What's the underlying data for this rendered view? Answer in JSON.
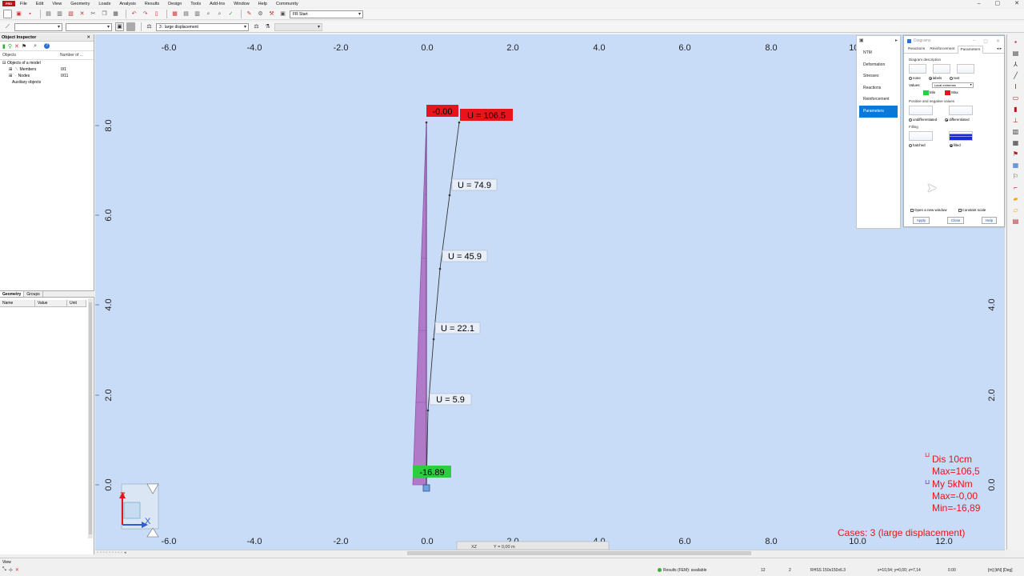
{
  "app": {
    "logo": "FRD"
  },
  "menu": [
    "File",
    "Edit",
    "View",
    "Geometry",
    "Loads",
    "Analysis",
    "Results",
    "Design",
    "Tools",
    "Add-Ins",
    "Window",
    "Help",
    "Community"
  ],
  "toolbar": {
    "start_combo": "FR Start",
    "case_combo": "3 : large displacement"
  },
  "object_inspector": {
    "title": "Object Inspector",
    "col_objects": "Objects",
    "col_number": "Number of ...",
    "tree": [
      {
        "label": "Objects of a model",
        "count": ""
      },
      {
        "label": "Members",
        "count": "0/1"
      },
      {
        "label": "Nodes",
        "count": "0/11"
      },
      {
        "label": "Auxiliary objects",
        "count": ""
      }
    ]
  },
  "bottom_tabs": [
    "Geometry",
    "Groups"
  ],
  "properties": {
    "name": "Name",
    "value": "Value",
    "unit": "Unit"
  },
  "diagram_nav": {
    "items": [
      "NTM",
      "Deformation",
      "Stresses",
      "Reactions",
      "Reinforcement",
      "Parameters"
    ],
    "active": "Parameters"
  },
  "diagrams_dialog": {
    "title": "Diagrams",
    "tabs": [
      "Reactions",
      "Reinforcement",
      "Parameters"
    ],
    "diagram_description": "Diagram description",
    "desc_options": [
      "none",
      "labels",
      "text"
    ],
    "values_label": "Values:",
    "values_combo": "Local extremes",
    "min_label": "Min",
    "max_label": "Max",
    "min_color": "#2ecc40",
    "max_color": "#e8141c",
    "posneg_label": "Positive and negative values",
    "posneg_options": [
      "undifferentiated",
      "differentiated"
    ],
    "filling_label": "Filling",
    "filling_options": [
      "hatched",
      "filled"
    ],
    "open_new_window": "Open a new window",
    "constant_scale": "Constant scale",
    "buttons": [
      "Apply",
      "Close",
      "Help"
    ]
  },
  "viewport": {
    "background": "#c8dcf8",
    "column_color": "#b07ac8",
    "labels": {
      "top_moment": "-0.00",
      "top_disp": "U = 106.5",
      "u1": "U = 74.9",
      "u2": "U = 45.9",
      "u3": "U = 22.1",
      "u4": "U = 5.9",
      "bottom_moment": "-16.89"
    },
    "x_ticks": [
      "-6.0",
      "-4.0",
      "-2.0",
      "0.0",
      "2.0",
      "4.0",
      "6.0",
      "8.0",
      "10.0",
      "12.0"
    ],
    "y_ticks_left": [
      "8.0",
      "6.0",
      "4.0",
      "2.0",
      "0.0"
    ],
    "y_ticks_right": [
      "4.0",
      "2.0",
      "0.0"
    ],
    "axis_x": "X",
    "axis_z": "Z",
    "legend": {
      "dis_line": "Dis  10cm",
      "dis_max": "Max=106,5",
      "my_line": "My  5kNm",
      "my_max": "Max=-0,00",
      "my_min": "Min=-16,89"
    },
    "cases": "Cases: 3 (large displacement)",
    "coord_box": "Y = 0,00 m",
    "plane": "XZ",
    "legend_color": "#e8141c"
  },
  "statusbar": {
    "view": "View",
    "results": "Results (FEM): available",
    "n1": "12",
    "n2": "2",
    "section": "RHSS 150x150x6.3",
    "coords": "x=10,54; y=0,00; z=7,14",
    "angle": "0.00",
    "units": "[m] [kN] [Deg]"
  }
}
